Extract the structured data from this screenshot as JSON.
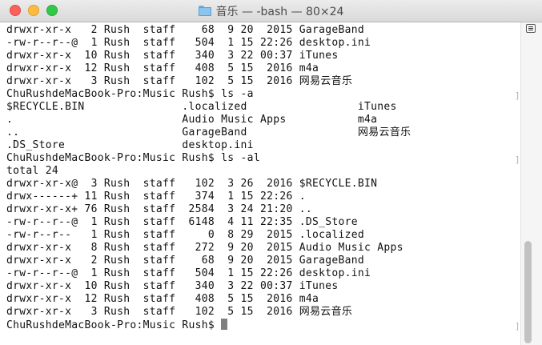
{
  "window": {
    "title": "音乐 — -bash — 80×24"
  },
  "terminal": {
    "lines": [
      "drwxr-xr-x   2 Rush  staff    68  9 20  2015 GarageBand",
      "-rw-r--r--@  1 Rush  staff   504  1 15 22:26 desktop.ini",
      "drwxr-xr-x  10 Rush  staff   340  3 22 00:37 iTunes",
      "drwxr-xr-x  12 Rush  staff   408  5 15  2016 m4a",
      "drwxr-xr-x   3 Rush  staff   102  5 15  2016 网易云音乐",
      "ChuRushdeMacBook-Pro:Music Rush$ ls -a",
      "$RECYCLE.BIN               .localized                 iTunes",
      ".                          Audio Music Apps           m4a",
      "..                         GarageBand                 网易云音乐",
      ".DS_Store                  desktop.ini",
      "ChuRushdeMacBook-Pro:Music Rush$ ls -al",
      "total 24",
      "drwxr-xr-x@  3 Rush  staff   102  3 26  2016 $RECYCLE.BIN",
      "drwx------+ 11 Rush  staff   374  1 15 22:26 .",
      "drwxr-xr-x+ 76 Rush  staff  2584  3 24 21:20 ..",
      "-rw-r--r--@  1 Rush  staff  6148  4 11 22:35 .DS_Store",
      "-rw-r--r--   1 Rush  staff     0  8 29  2015 .localized",
      "drwxr-xr-x   8 Rush  staff   272  9 20  2015 Audio Music Apps",
      "drwxr-xr-x   2 Rush  staff    68  9 20  2015 GarageBand",
      "-rw-r--r--@  1 Rush  staff   504  1 15 22:26 desktop.ini",
      "drwxr-xr-x  10 Rush  staff   340  3 22 00:37 iTunes",
      "drwxr-xr-x  12 Rush  staff   408  5 15  2016 m4a",
      "drwxr-xr-x   3 Rush  staff   102  5 15  2016 网易云音乐"
    ],
    "prompt": "ChuRushdeMacBook-Pro:Music Rush$ "
  },
  "icons": {
    "folder": "folder-icon",
    "menu": "list-menu-icon",
    "cursor": "block-cursor"
  },
  "colors": {
    "close": "#fc605c",
    "minimize": "#fdbc40",
    "maximize": "#34c84a",
    "text": "#111111",
    "background": "#ffffff"
  }
}
